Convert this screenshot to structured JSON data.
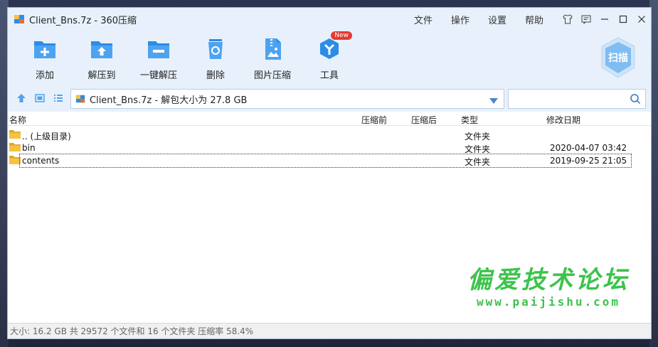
{
  "window": {
    "title": "Client_Bns.7z - 360压缩",
    "menu": [
      "文件",
      "操作",
      "设置",
      "帮助"
    ]
  },
  "toolbar": {
    "items": [
      {
        "label": "添加",
        "icon": "add-icon"
      },
      {
        "label": "解压到",
        "icon": "extract-to-icon"
      },
      {
        "label": "一键解压",
        "icon": "one-click-extract-icon"
      },
      {
        "label": "删除",
        "icon": "recycle-bin-icon"
      },
      {
        "label": "图片压缩",
        "icon": "image-compress-icon"
      },
      {
        "label": "工具",
        "icon": "tools-icon",
        "badge": "New"
      }
    ],
    "scan_label": "扫描"
  },
  "nav": {
    "path": "Client_Bns.7z - 解包大小为 27.8 GB",
    "search_placeholder": ""
  },
  "columns": {
    "name": "名称",
    "packed": "压缩前",
    "compressed": "压缩后",
    "type": "类型",
    "modified": "修改日期"
  },
  "rows": [
    {
      "name": ".. (上级目录)",
      "type": "文件夹",
      "modified": ""
    },
    {
      "name": "bin",
      "type": "文件夹",
      "modified": "2020-04-07 03:42"
    },
    {
      "name": "contents",
      "type": "文件夹",
      "modified": "2019-09-25 21:05"
    }
  ],
  "status": "大小: 16.2 GB 共 29572 个文件和 16 个文件夹 压缩率 58.4%",
  "watermark": {
    "title": "偏爱技术论坛",
    "url": "www.paijishu.com"
  },
  "colors": {
    "accent": "#2b8de8",
    "titlebar": "#e8f1fb",
    "folder": "#f5c242",
    "watermark": "#3cc34b",
    "badge": "#e53935"
  }
}
